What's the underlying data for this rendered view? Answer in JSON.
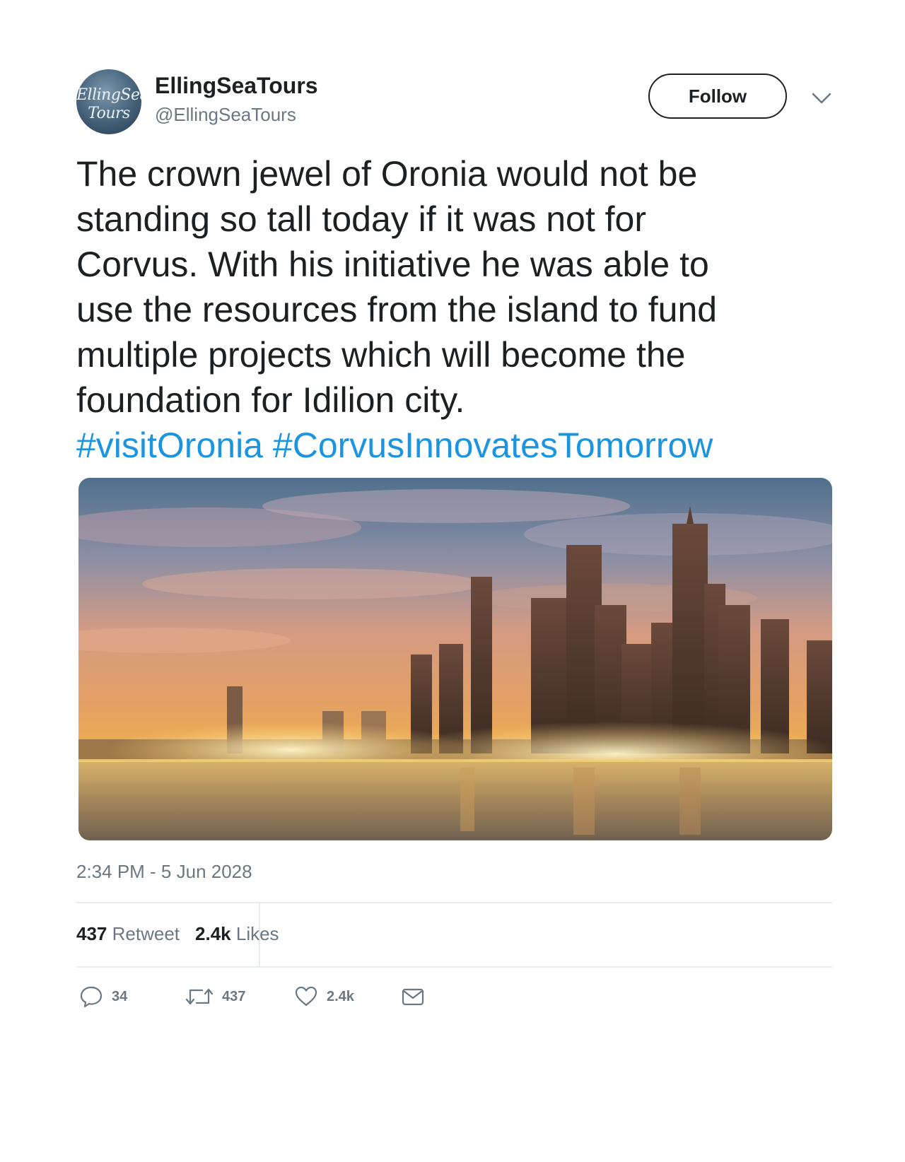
{
  "user": {
    "display_name": "EllingSeaTours",
    "handle": "@EllingSeaTours",
    "avatar_text_line1": "EllingSea",
    "avatar_text_line2": "Tours"
  },
  "header": {
    "follow_label": "Follow",
    "more_icon": "chevron-down-icon"
  },
  "tweet": {
    "text_lines": [
      "The crown jewel of Oronia would not be",
      "standing so tall today if it was not for",
      "Corvus. With his initiative he was able to",
      "use the resources from the island to fund",
      "multiple projects which will become the",
      "foundation for Idilion city."
    ],
    "hashtags": [
      "#visitOronia",
      "#CorvusInnovatesTomorrow"
    ],
    "hashtag_color": "#1b95e0",
    "media_alt": "city skyline at sunset"
  },
  "meta": {
    "timestamp": "2:34 PM - 5 Jun 2028"
  },
  "stats": {
    "retweets_count": "437",
    "retweets_label": "Retweet",
    "likes_count": "2.4k",
    "likes_label": "Likes"
  },
  "actions": {
    "reply_count": "34",
    "retweet_count": "437",
    "like_count": "2.4k",
    "reply_icon": "reply-bubble-icon",
    "retweet_icon": "retweet-icon",
    "like_icon": "heart-icon",
    "dm_icon": "envelope-icon"
  },
  "colors": {
    "text": "#1c2022",
    "secondary": "#697882",
    "divider": "#e6ecf0"
  }
}
